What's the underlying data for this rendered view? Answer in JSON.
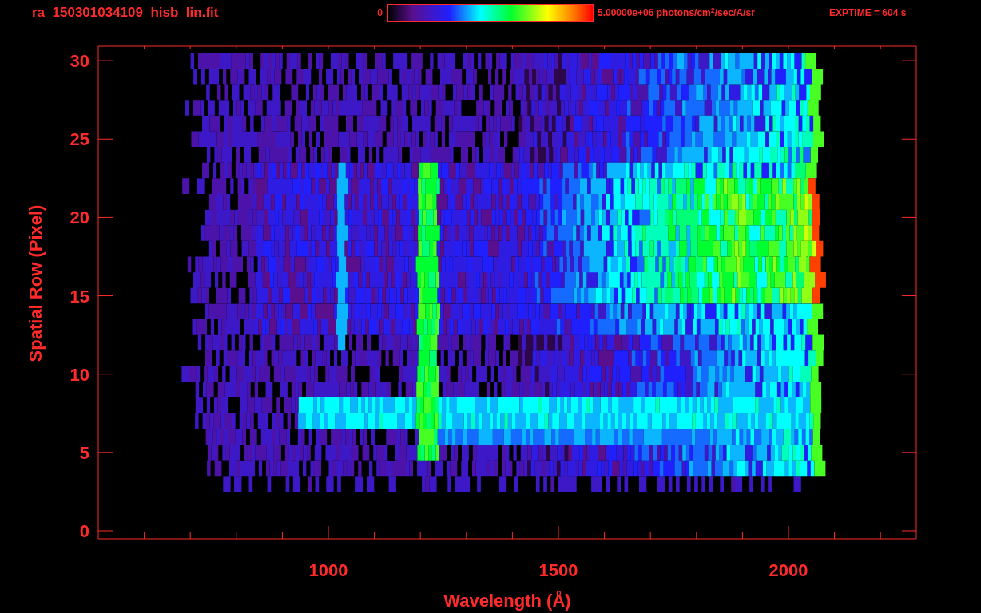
{
  "title": "ra_150301034109_hisb_lin.fit",
  "colorbar": {
    "min_label": "0",
    "max_label": "5.00000e+06 photons/cm$^{2}$/sec/A/sr"
  },
  "exptime": "EXPTIME = 604 s",
  "plot": {
    "xlabel": "Wavelength (Å)",
    "ylabel": "Spatial Row (Pixel)",
    "xticks": [
      "1000",
      "1500",
      "2000"
    ],
    "yticks": [
      "30",
      "25",
      "20",
      "15",
      "10",
      "5",
      "0"
    ]
  }
}
